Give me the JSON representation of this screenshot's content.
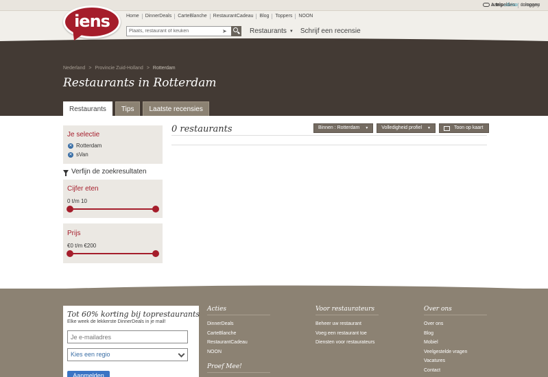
{
  "tripadvisor": {
    "prefix": "a",
    "trip": "trip",
    "advisor": "advisor",
    "suffix": "company"
  },
  "auth": {
    "login": "Aanmelden",
    "signin": "Inloggen"
  },
  "logo": {
    "text": "iens"
  },
  "topnav": [
    "Home",
    "DinnerDeals",
    "CarteBlanche",
    "RestaurantCadeau",
    "Blog",
    "Toppers",
    "NOON"
  ],
  "search": {
    "placeholder": "Plaats, restaurant of keuken"
  },
  "mainnav": {
    "restaurants": "Restaurants",
    "review": "Schrijf een recensie"
  },
  "breadcrumb": {
    "level1": "Nederland",
    "level2": "Provincie Zuid-Holland",
    "current": "Rotterdam",
    "sep": ">"
  },
  "page_title": "Restaurants in Rotterdam",
  "tabs": [
    "Restaurants",
    "Tips",
    "Laatste recensies"
  ],
  "selection": {
    "title": "Je selectie",
    "chips": [
      "Rotterdam",
      "sVan"
    ]
  },
  "refine_label": "Verfijn de zoekresultaten",
  "cijfer": {
    "title": "Cijfer eten",
    "range": "0 t/m 10",
    "min": 0,
    "max": 10
  },
  "prijs": {
    "title": "Prijs",
    "range": "€0 t/m €200",
    "min": 0,
    "max": 200
  },
  "results": {
    "count_label": "0 restaurants"
  },
  "filters": {
    "within": "Binnen : Rotterdam",
    "completeness": "Volledigheid profiel",
    "map": "Toon op kaart"
  },
  "promo": {
    "title": "Tot 60% korting bij toprestaurants",
    "subtitle": "Elke week de lekkerste DinnerDeals in je mail!",
    "email_placeholder": "Je e-mailadres",
    "region_placeholder": "Kies een regio",
    "subscribe": "Aanmelden"
  },
  "footer": {
    "acties": {
      "title": "Acties",
      "items": [
        "DinnerDeals",
        "CarteBlanche",
        "RestaurantCadeau",
        "NOON"
      ]
    },
    "restaurateurs": {
      "title": "Voor restaurateurs",
      "items": [
        "Beheer uw restaurant",
        "Voeg een restaurant toe",
        "Diensten voor restaurateurs"
      ]
    },
    "over": {
      "title": "Over ons",
      "items": [
        "Over ons",
        "Blog",
        "Mobiel",
        "Veelgestelde vragen",
        "Vacatures",
        "Contact"
      ]
    },
    "proefmee": "Proef Mee!"
  }
}
